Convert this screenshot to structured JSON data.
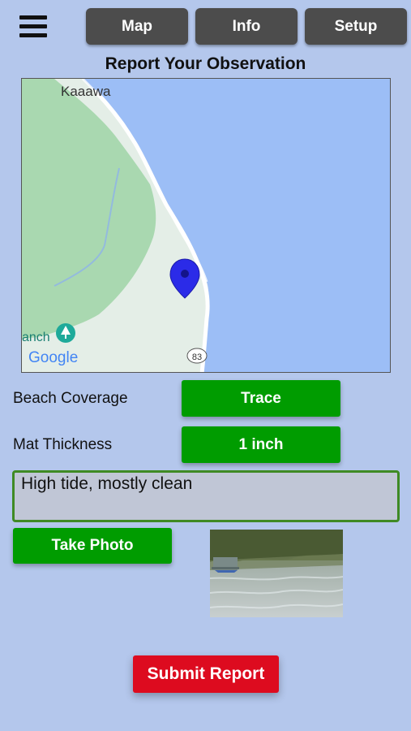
{
  "nav": {
    "menu_icon": "hamburger-menu-icon",
    "tabs": [
      {
        "label": "Map"
      },
      {
        "label": "Info"
      },
      {
        "label": "Setup"
      }
    ]
  },
  "page_title": "Report Your Observation",
  "map": {
    "place_label": "Kaaawa",
    "poi_label": "anch",
    "attribution": "Google",
    "route_shield": "83",
    "pin_icon": "location-pin-icon",
    "colors": {
      "water": "#9cbef6",
      "land": "#e4eee7",
      "park": "#a9d8b0",
      "pin": "#2b2be8"
    }
  },
  "form": {
    "beach_coverage": {
      "label": "Beach Coverage",
      "value": "Trace"
    },
    "mat_thickness": {
      "label": "Mat Thickness",
      "value": "1 inch"
    },
    "notes": {
      "value": "High tide, mostly clean"
    }
  },
  "photo": {
    "button_label": "Take Photo"
  },
  "submit": {
    "label": "Submit Report"
  },
  "colors": {
    "background": "#b4c7ec",
    "tab_bg": "#4c4c4c",
    "accent_green": "#009c00",
    "submit_red": "#dd0b1f"
  }
}
